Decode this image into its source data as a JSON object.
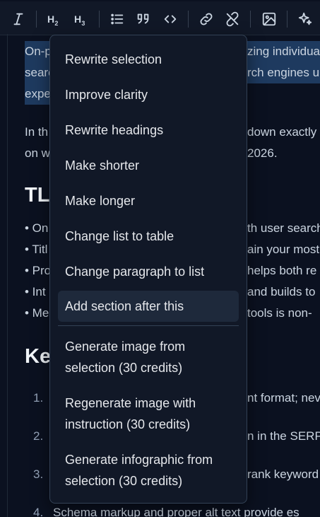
{
  "toolbar": {
    "items": [
      {
        "icon": "italic-icon"
      },
      {
        "label_main": "H",
        "label_sub": "2"
      },
      {
        "label_main": "H",
        "label_sub": "3"
      },
      {
        "icon": "bullet-list-icon"
      },
      {
        "icon": "quote-icon"
      },
      {
        "icon": "code-icon"
      },
      {
        "icon": "link-icon"
      },
      {
        "icon": "unlink-icon"
      },
      {
        "icon": "image-icon"
      },
      {
        "icon": "ai-sparkle-icon"
      }
    ]
  },
  "content": {
    "selected_lines": [
      "On-p",
      "searc",
      "expe"
    ],
    "selected_lines_right": [
      "zing individua",
      "rch engines u"
    ],
    "para2_line1_left": "In th",
    "para2_line1_right": "down exactly",
    "para2_line2_left": "on w",
    "para2_line2_right": "2026.",
    "heading1": "TL;",
    "bullets": [
      {
        "left": "• On",
        "right": "th user search"
      },
      {
        "left": "• Titl",
        "right": "ain your most"
      },
      {
        "left": "• Pro",
        "right": "helps both re"
      },
      {
        "left": "• Int",
        "right": "and builds to"
      },
      {
        "left": "• Me",
        "right": "tools is non-"
      }
    ],
    "heading2": "Key",
    "ordered": [
      {
        "num": "1.",
        "right": "nt format; nev"
      },
      {
        "num": "2.",
        "right": "n in the SERP"
      },
      {
        "num": "3.",
        "right": "rank keyword"
      },
      {
        "num": "4.",
        "text": "Schema markup and proper alt text provide es"
      }
    ]
  },
  "menu": {
    "items": [
      {
        "label": "Rewrite selection"
      },
      {
        "label": "Improve clarity"
      },
      {
        "label": "Rewrite headings"
      },
      {
        "label": "Make shorter"
      },
      {
        "label": "Make longer"
      },
      {
        "label": "Change list to table"
      },
      {
        "label": "Change paragraph to list"
      },
      {
        "label": "Add section after this",
        "highlighted": true
      }
    ],
    "credit_items": [
      {
        "line1": "Generate image from",
        "line2": "selection (30 credits)"
      },
      {
        "line1": "Regenerate image with",
        "line2": "instruction (30 credits)"
      },
      {
        "line1": "Generate infographic from",
        "line2": "selection (30 credits)"
      }
    ]
  }
}
